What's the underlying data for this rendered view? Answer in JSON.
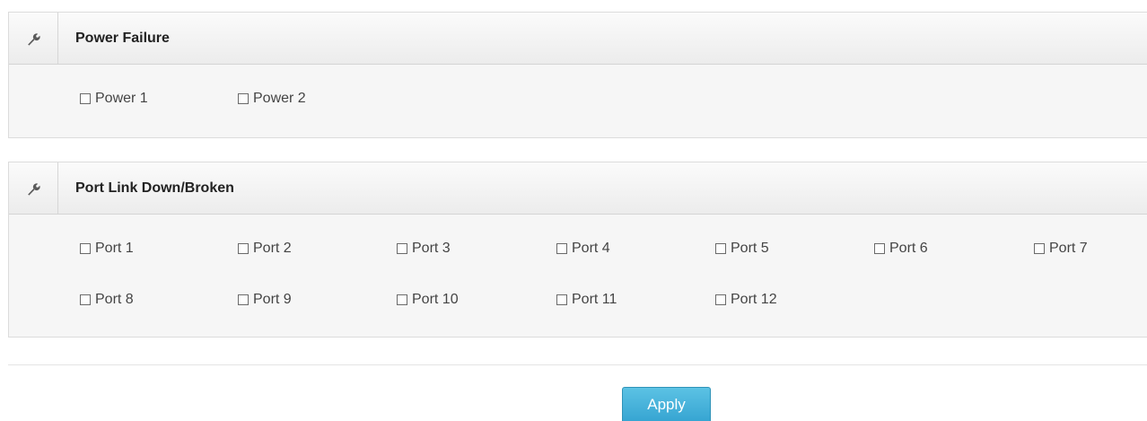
{
  "power_section": {
    "icon": "wrench-icon",
    "title": "Power Failure",
    "options": [
      "Power 1",
      "Power 2"
    ]
  },
  "port_section": {
    "icon": "wrench-icon",
    "title": "Port Link Down/Broken",
    "options": [
      "Port 1",
      "Port 2",
      "Port 3",
      "Port 4",
      "Port 5",
      "Port 6",
      "Port 7",
      "Port 8",
      "Port 9",
      "Port 10",
      "Port 11",
      "Port 12"
    ]
  },
  "actions": {
    "apply_label": "Apply"
  },
  "colors": {
    "apply_button": "#3cabd6",
    "panel_background": "#f6f6f6",
    "header_background": "#ececec"
  }
}
